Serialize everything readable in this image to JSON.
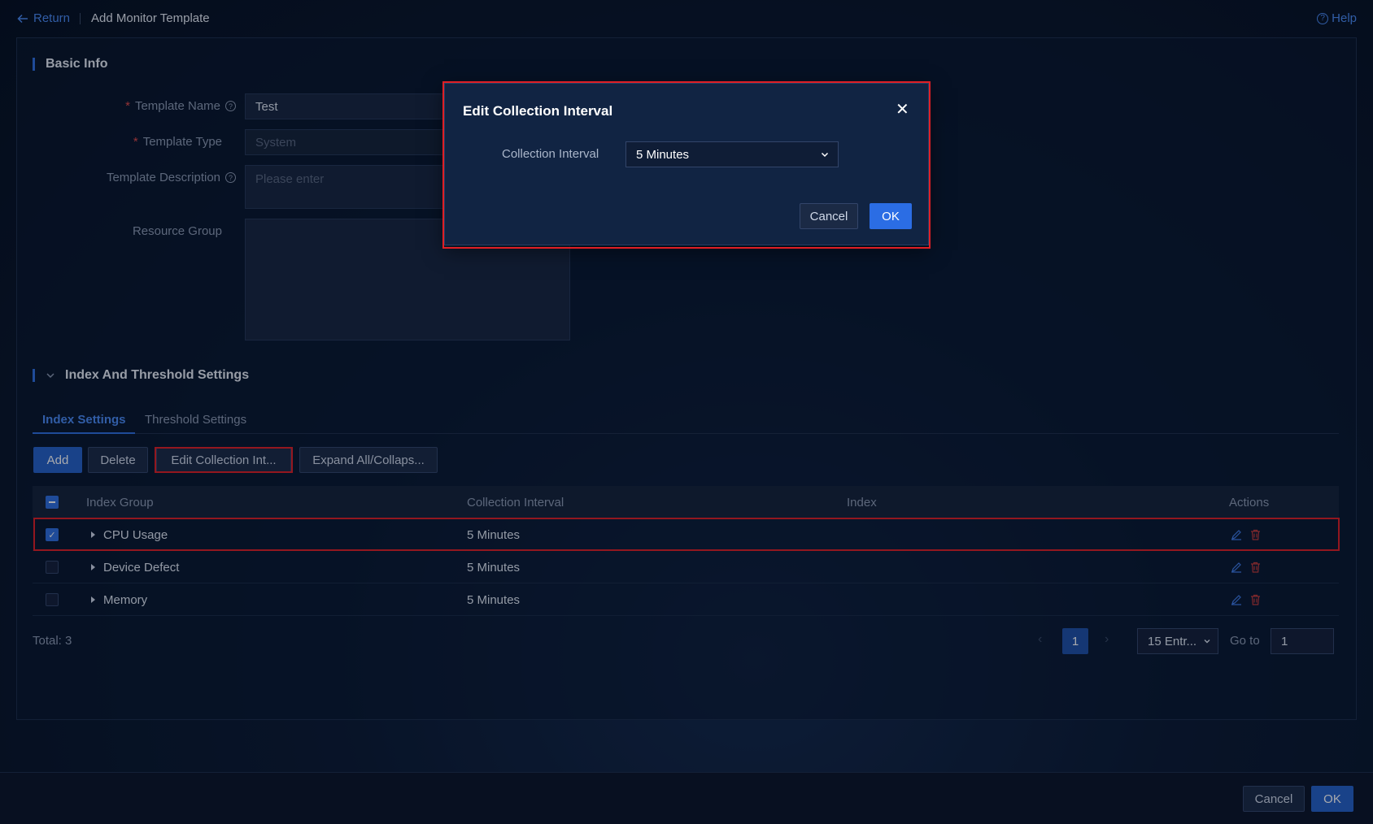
{
  "header": {
    "return_label": "Return",
    "page_title": "Add Monitor Template",
    "help_label": "Help"
  },
  "basic_info": {
    "section_title": "Basic Info",
    "template_name_label": "Template Name",
    "template_name_value": "Test",
    "template_type_label": "Template Type",
    "template_type_value": "System",
    "template_description_label": "Template Description",
    "template_description_placeholder": "Please enter",
    "resource_group_label": "Resource Group"
  },
  "index_section": {
    "section_title": "Index And Threshold Settings",
    "tabs": [
      {
        "label": "Index Settings",
        "active": true
      },
      {
        "label": "Threshold Settings",
        "active": false
      }
    ],
    "toolbar": {
      "add_label": "Add",
      "delete_label": "Delete",
      "edit_interval_label": "Edit Collection Int...",
      "expand_label": "Expand All/Collaps..."
    },
    "table": {
      "columns": [
        "Index Group",
        "Collection Interval",
        "Index",
        "Actions"
      ],
      "rows": [
        {
          "group": "CPU Usage",
          "interval": "5 Minutes",
          "index": "",
          "checked": true
        },
        {
          "group": "Device Defect",
          "interval": "5 Minutes",
          "index": "",
          "checked": false
        },
        {
          "group": "Memory",
          "interval": "5 Minutes",
          "index": "",
          "checked": false
        }
      ]
    },
    "pagination": {
      "total_label": "Total: 3",
      "current_page": "1",
      "page_size_label": "15 Entr...",
      "goto_label": "Go to",
      "goto_value": "1"
    }
  },
  "footer": {
    "cancel_label": "Cancel",
    "ok_label": "OK"
  },
  "dialog": {
    "title": "Edit Collection Interval",
    "field_label": "Collection Interval",
    "selected_value": "5 Minutes",
    "cancel_label": "Cancel",
    "ok_label": "OK"
  },
  "colors": {
    "accent": "#2f6fe0",
    "highlight_border": "#e01f25",
    "background": "#0b1a33"
  }
}
